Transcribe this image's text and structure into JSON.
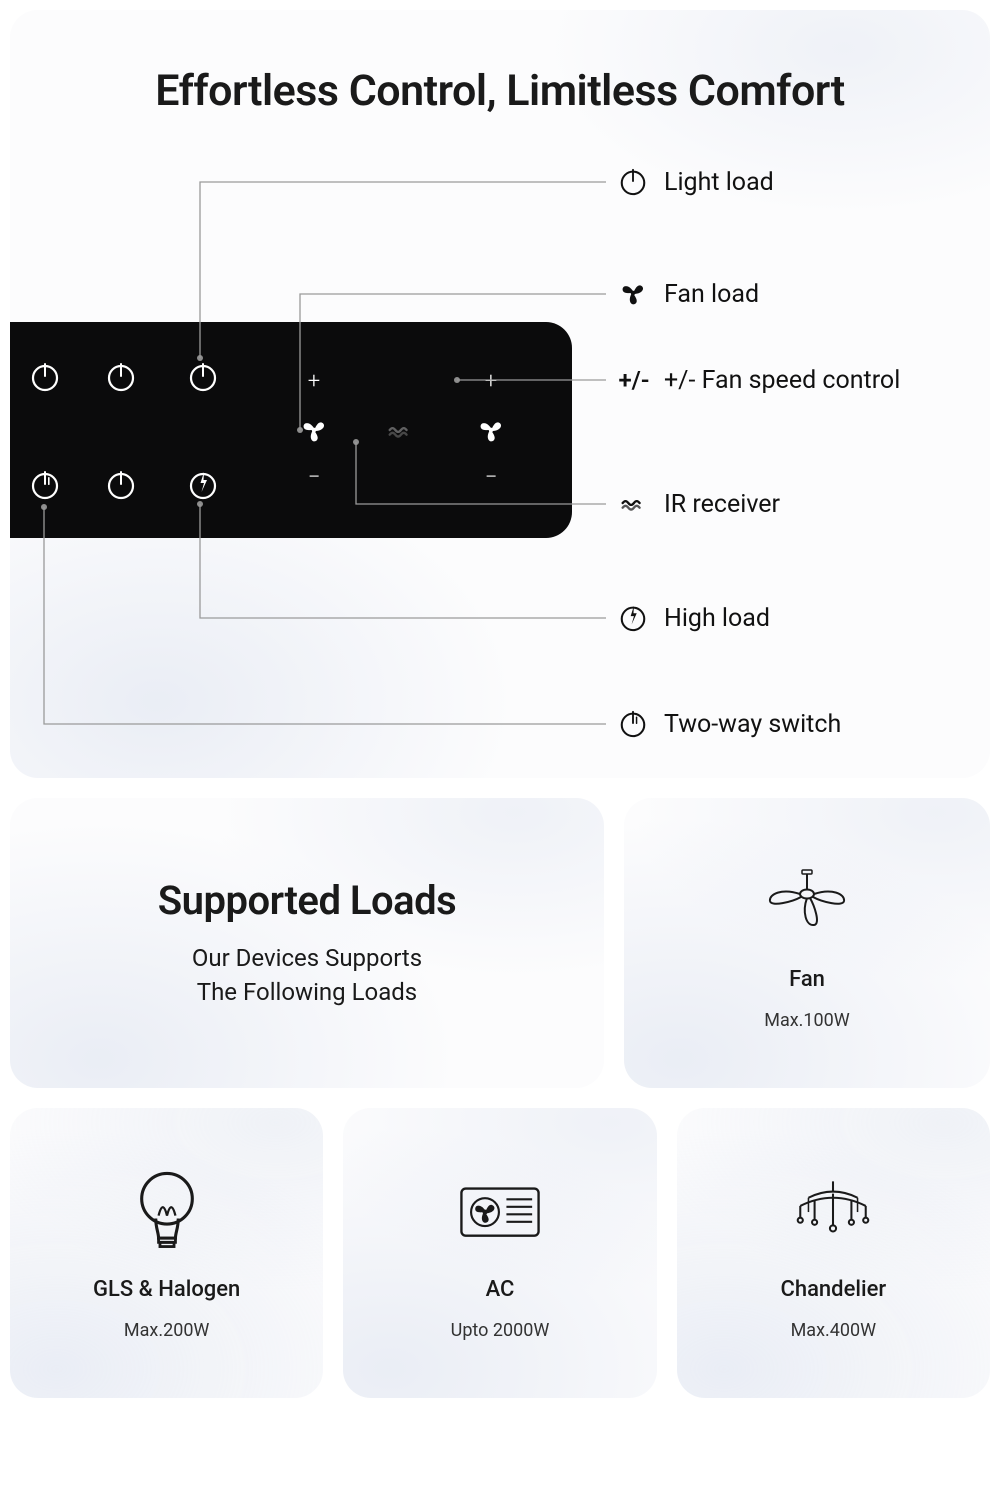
{
  "hero": {
    "title": "Effortless Control, Limitless Comfort"
  },
  "panel": {
    "symbols": {
      "plus": "+",
      "minus": "−"
    }
  },
  "labels": {
    "light_load": "Light load",
    "fan_load": "Fan load",
    "speed_control": "+/- Fan speed control",
    "ir_receiver": "IR receiver",
    "high_load": "High load",
    "two_way": "Two-way switch"
  },
  "loads": {
    "title": "Supported Loads",
    "subtitle_line1": "Our Devices Supports",
    "subtitle_line2": "The Following Loads"
  },
  "tiles": {
    "fan": {
      "name": "Fan",
      "max": "Max.100W"
    },
    "gls": {
      "name": "GLS & Halogen",
      "max": "Max.200W"
    },
    "ac": {
      "name": "AC",
      "max": "Upto 2000W"
    },
    "chandelier": {
      "name": "Chandelier",
      "max": "Max.400W"
    }
  }
}
